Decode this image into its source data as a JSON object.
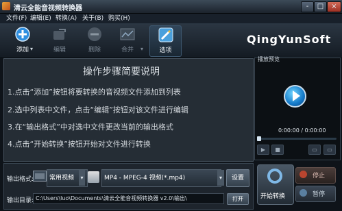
{
  "window": {
    "title": "清云全能音视频转换器",
    "minimize": "-",
    "maximize": "□",
    "close": "×"
  },
  "menu": {
    "file": "文件(F)",
    "edit": "编辑(E)",
    "convert": "转换(A)",
    "about": "关于(B)",
    "buy": "购买(H)"
  },
  "toolbar": {
    "add": "添加",
    "edit": "编辑",
    "delete": "删除",
    "merge": "合并",
    "options": "选项",
    "add_dropdown": "▾"
  },
  "brand": "QingYunSoft",
  "instructions": {
    "heading": "操作步骤简要说明",
    "steps": [
      "1.点击“添加”按钮将要转换的音视频文件添加到列表",
      "2.选中列表中文件，点击“编辑”按钮对该文件进行编辑",
      "3.在“输出格式”中对选中文件更改当前的输出格式",
      "4.点击“开始转换”按钮开始对文件进行转换"
    ]
  },
  "preview": {
    "title": "播放预览",
    "time": "0:00:00 / 0:00:00",
    "progress": 0,
    "controls": [
      "▶",
      "■",
      "▭",
      "▭"
    ]
  },
  "output": {
    "format_label": "输出格式:",
    "format_category": "常用视频",
    "format_value": "MP4 - MPEG-4 视频(*.mp4)",
    "settings": "设置",
    "dir_label": "输出目录:",
    "dir_value": "C:\\Users\\luo\\Documents\\清云全能音视频转换器 v2.0\\输出\\",
    "browse": "打开",
    "arrow": "▾"
  },
  "actions": {
    "start": "开始转换",
    "stop": "停止",
    "pause": "暂停"
  },
  "colors": {
    "background": "#0e1319",
    "panel": "#252d35",
    "accent": "#1479c8"
  }
}
